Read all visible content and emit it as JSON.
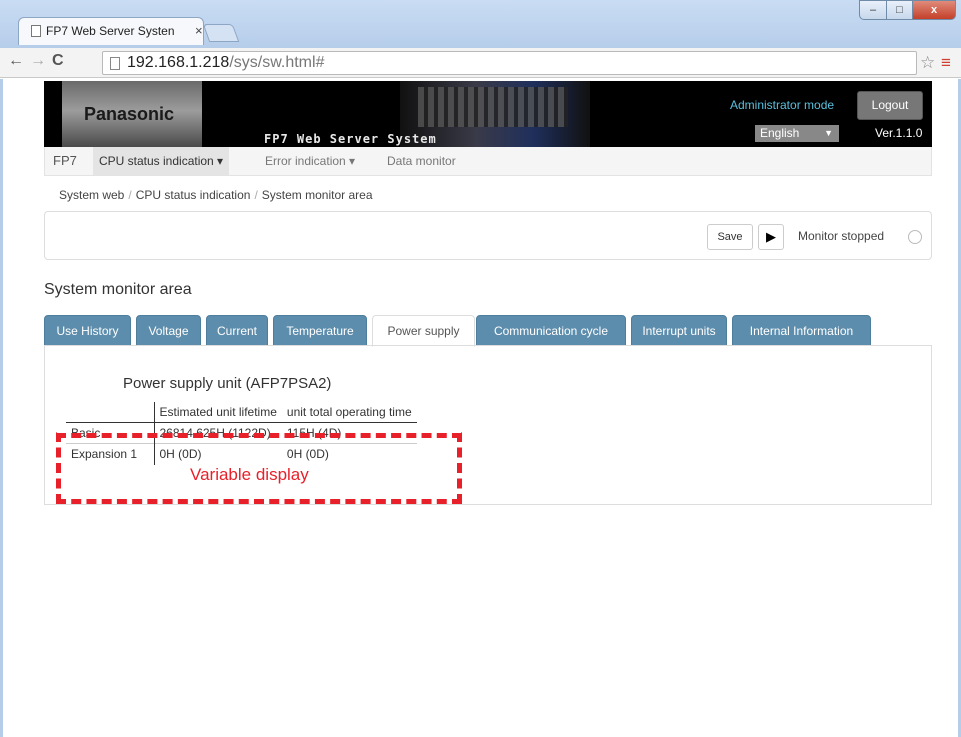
{
  "browser": {
    "tab_title": "FP7 Web Server Systen",
    "tab_close": "×",
    "url_host": "192.168.1.218",
    "url_path": "/sys/sw.html#",
    "win_min": "–",
    "win_max": "□",
    "win_close": "x",
    "back": "←",
    "forward": "→",
    "reload": "C",
    "star": "☆",
    "menu": "≡"
  },
  "header": {
    "logo": "Panasonic",
    "hero_caption": "FP7 Web Server System",
    "admin_mode": "Administrator mode",
    "logout": "Logout",
    "language": "English",
    "language_caret": "▼",
    "version": "Ver.1.1.0"
  },
  "navbar": {
    "brand": "FP7",
    "items": [
      {
        "label": "CPU status indication ▾"
      },
      {
        "label": "Error indication ▾"
      },
      {
        "label": "Data monitor"
      }
    ]
  },
  "breadcrumb": [
    "System web",
    "CPU status indication",
    "System monitor area"
  ],
  "breadcrumb_sep": "/",
  "controls": {
    "save": "Save",
    "play": "▶",
    "status": "Monitor stopped"
  },
  "section_title": "System monitor area",
  "tabs": [
    {
      "label": "Use History"
    },
    {
      "label": "Voltage"
    },
    {
      "label": "Current"
    },
    {
      "label": "Temperature"
    },
    {
      "label": "Power supply"
    },
    {
      "label": "Communication cycle"
    },
    {
      "label": "Interrupt units"
    },
    {
      "label": "Internal Information"
    }
  ],
  "active_tab": "Power supply",
  "power_supply": {
    "unit_title": "Power supply unit (AFP7PSA2)",
    "columns": [
      "",
      "Estimated unit lifetime",
      "unit total operating time"
    ],
    "rows": [
      [
        "Basic",
        "26814.625H (1122D)",
        "115H (4D)"
      ],
      [
        "Expansion 1",
        "0H (0D)",
        "0H (0D)"
      ]
    ]
  },
  "annotation": "Variable display",
  "colors": {
    "tab_bg": "#5d8dac",
    "annotation": "#e8202a",
    "admin_mode": "#5bc0de"
  }
}
